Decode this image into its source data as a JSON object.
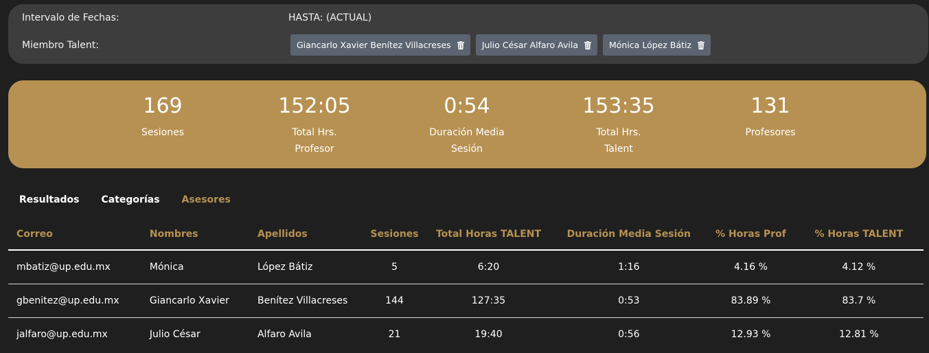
{
  "filters": {
    "date_label": "Intervalo de Fechas:",
    "date_value": "HASTA: (ACTUAL)",
    "member_label": "Miembro Talent:",
    "members": [
      "Giancarlo Xavier Benítez Villacreses",
      "Julio César Alfaro Avila",
      "Mónica López Bátiz"
    ]
  },
  "summary": {
    "stats": [
      {
        "value": "169",
        "label_1": "Sesiones",
        "label_2": ""
      },
      {
        "value": "152:05",
        "label_1": "Total Hrs.",
        "label_2": "Profesor"
      },
      {
        "value": "0:54",
        "label_1": "Duración Media",
        "label_2": "Sesión"
      },
      {
        "value": "153:35",
        "label_1": "Total Hrs.",
        "label_2": "Talent"
      },
      {
        "value": "131",
        "label_1": "Profesores",
        "label_2": ""
      }
    ]
  },
  "tabs": [
    {
      "label": "Resultados"
    },
    {
      "label": "Categorías"
    },
    {
      "label": "Asesores"
    }
  ],
  "table": {
    "headers": [
      "Correo",
      "Nombres",
      "Apellidos",
      "Sesiones",
      "Total Horas TALENT",
      "Duración Media Sesión",
      "% Horas Prof",
      "% Horas TALENT"
    ],
    "rows": [
      [
        "mbatiz@up.edu.mx",
        "Mónica",
        "López Bátiz",
        "5",
        "6:20",
        "1:16",
        "4.16 %",
        "4.12 %"
      ],
      [
        "gbenitez@up.edu.mx",
        "Giancarlo Xavier",
        "Benítez Villacreses",
        "144",
        "127:35",
        "0:53",
        "83.89 %",
        "83.7 %"
      ],
      [
        "jalfaro@up.edu.mx",
        "Julio César",
        "Alfaro Avila",
        "21",
        "19:40",
        "0:56",
        "12.93 %",
        "12.81 %"
      ]
    ]
  },
  "colors": {
    "accent": "#b79152",
    "background": "#1f1f1f",
    "panel": "#3d3d3d",
    "chip": "#5b6470"
  },
  "icons": {
    "chip_remove": "trash-icon"
  }
}
